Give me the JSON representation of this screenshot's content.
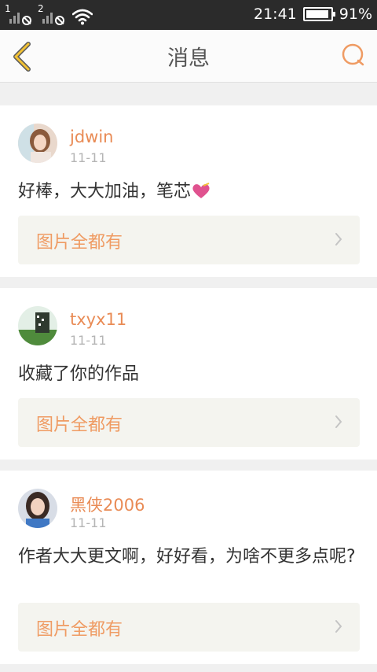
{
  "status_bar": {
    "sim1": "1",
    "sim2": "2",
    "time": "21:41",
    "battery": "91%",
    "battery_level": 0.91
  },
  "header": {
    "title": "消息"
  },
  "messages": [
    {
      "username": "jdwin",
      "date": "11-11",
      "text": "好棒，大大加油，笔芯",
      "attachment_label": "图片全都有"
    },
    {
      "username": "txyx11",
      "date": "11-11",
      "text": "收藏了你的作品",
      "attachment_label": "图片全都有"
    },
    {
      "username": "黑侠2006",
      "date": "11-11",
      "text": "作者大大更文啊，好好看，为啥不更多点呢?",
      "attachment_label": "图片全都有"
    }
  ],
  "colors": {
    "accent": "#e98b55",
    "attachment_bg": "#f4f4ef",
    "status_bar_bg": "#2b2b2b"
  },
  "icons": {
    "back": "chevron-left-icon",
    "search": "search-icon",
    "attachment": "chevron-right-icon",
    "emoji": "heart-icon"
  }
}
